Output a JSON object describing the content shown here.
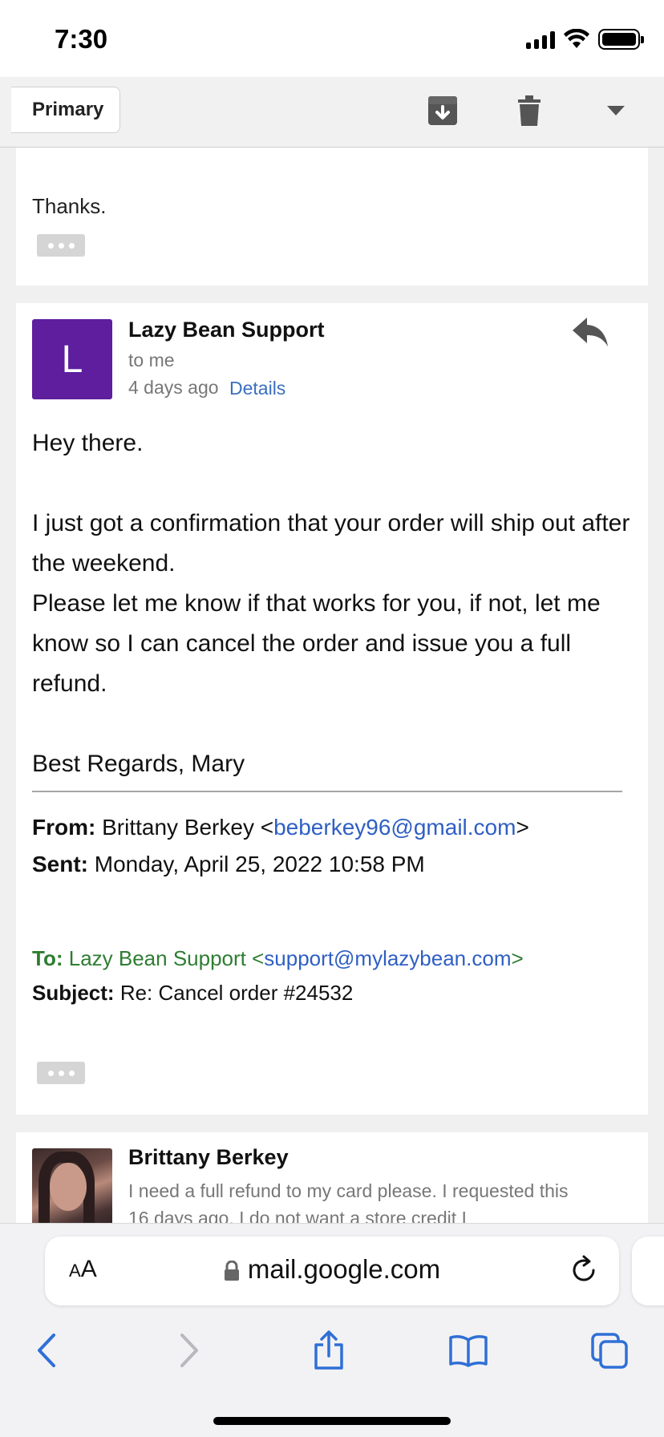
{
  "status_bar": {
    "time": "7:30"
  },
  "toolbar": {
    "back_label": "Primary",
    "icons": [
      "archive-icon",
      "trash-icon",
      "more-dropdown-icon"
    ]
  },
  "previous_message": {
    "text": "Thanks."
  },
  "message": {
    "avatar_letter": "L",
    "avatar_color": "#5e1e9e",
    "sender": "Lazy Bean Support",
    "to": "to me",
    "time": "4 days ago",
    "details_link": "Details",
    "body": {
      "greeting": "Hey there.",
      "line1": "I just got a confirmation that your order will ship out after the weekend.",
      "line2": "Please let me know if that works for you, if not, let me know so I can cancel the order and issue you a full refund.",
      "signoff": "Best Regards, Mary"
    },
    "quoted": {
      "from_label": "From:",
      "from_name": "Brittany Berkey <",
      "from_email": "beberkey96@gmail.com",
      "from_close": ">",
      "sent_label": "Sent:",
      "sent_value": "Monday, April 25, 2022 10:58 PM",
      "to_label": "To:",
      "to_name": "Lazy Bean Support <",
      "to_email": "support@mylazybean.com",
      "to_close": ">",
      "subject_label": "Subject:",
      "subject_value": "Re: Cancel order #24532"
    }
  },
  "next_message": {
    "sender": "Brittany Berkey",
    "snippet": "I need a full refund to my card please. I requested this 16 days ago. I do not want a store credit I"
  },
  "safari": {
    "aa_small": "A",
    "aa_large": "A",
    "url": "mail.google.com"
  },
  "colors": {
    "link": "#2f5fc4",
    "quoted_to": "#2e7d32",
    "avatar": "#5e1e9e"
  }
}
